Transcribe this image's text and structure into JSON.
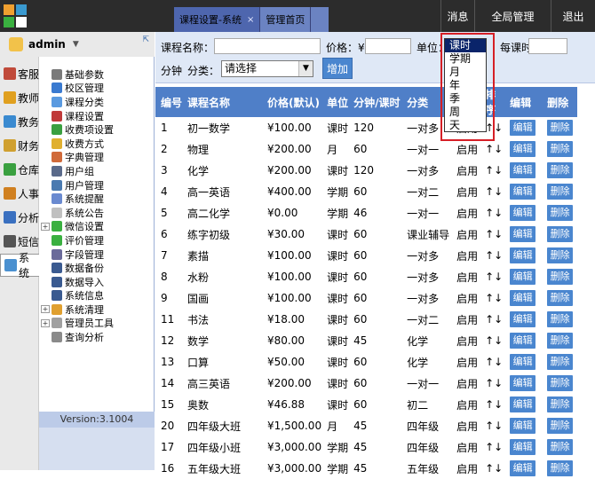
{
  "topbar": {
    "tabs": [
      {
        "label": "课程设置-系统",
        "close": "×",
        "active": true
      },
      {
        "label": "管理首页",
        "active": false
      }
    ],
    "buttons": [
      "消息",
      "全局管理",
      "退出"
    ]
  },
  "user": {
    "name": "admin",
    "caret": "▼",
    "pin": "⇱"
  },
  "rail": [
    {
      "label": "客服",
      "icon": "service-icon",
      "color": "#c04a3a"
    },
    {
      "label": "教师",
      "icon": "teacher-icon",
      "color": "#e0a020"
    },
    {
      "label": "教务",
      "icon": "academic-icon",
      "color": "#3a8ad0"
    },
    {
      "label": "财务",
      "icon": "finance-icon",
      "color": "#d0a030"
    },
    {
      "label": "仓库",
      "icon": "warehouse-icon",
      "color": "#3aa040"
    },
    {
      "label": "人事",
      "icon": "hr-icon",
      "color": "#d08020"
    },
    {
      "label": "分析",
      "icon": "analysis-icon",
      "color": "#3a70c0"
    },
    {
      "label": "短信",
      "icon": "sms-icon",
      "color": "#555555"
    },
    {
      "label": "系统",
      "icon": "system-icon",
      "color": "#4a90d0"
    }
  ],
  "tree": [
    {
      "label": "基础参数",
      "exp": "",
      "color": "#7a7a7a"
    },
    {
      "label": "校区管理",
      "exp": "",
      "color": "#3a7ad0"
    },
    {
      "label": "课程分类",
      "exp": "",
      "color": "#5a9ae0"
    },
    {
      "label": "课程设置",
      "exp": "",
      "color": "#c03a3a"
    },
    {
      "label": "收费项设置",
      "exp": "",
      "color": "#3aa040"
    },
    {
      "label": "收费方式",
      "exp": "",
      "color": "#e0b030"
    },
    {
      "label": "字典管理",
      "exp": "",
      "color": "#d06a3a"
    },
    {
      "label": "用户组",
      "exp": "",
      "color": "#5a6a8a"
    },
    {
      "label": "用户管理",
      "exp": "",
      "color": "#4a7ab0"
    },
    {
      "label": "系统提醒",
      "exp": "",
      "color": "#6a8ad0"
    },
    {
      "label": "系统公告",
      "exp": "",
      "color": "#c0c0c0"
    },
    {
      "label": "微信设置",
      "exp": "+",
      "color": "#3ab040"
    },
    {
      "label": "评价管理",
      "exp": "",
      "color": "#3ab040"
    },
    {
      "label": "字段管理",
      "exp": "",
      "color": "#6a6a9a"
    },
    {
      "label": "数据备份",
      "exp": "",
      "color": "#3a5a90"
    },
    {
      "label": "数据导入",
      "exp": "",
      "color": "#3a5a90"
    },
    {
      "label": "系统信息",
      "exp": "",
      "color": "#3a5a90"
    },
    {
      "label": "系统清理",
      "exp": "+",
      "color": "#e0a030"
    },
    {
      "label": "管理员工具",
      "exp": "+",
      "color": "#a0a0a0"
    },
    {
      "label": "查询分析",
      "exp": "",
      "color": "#8a8a8a"
    }
  ],
  "version": "Version:3.1004",
  "filter": {
    "course_name_label": "课程名称：",
    "price_label": "价格：¥",
    "unit_label": "单位：",
    "per_class_label": "每课时：",
    "minutes_label": "分钟",
    "category_label": "分类：",
    "category_value": "请选择",
    "add_label": "增加"
  },
  "unit_options": [
    "课时",
    "学期",
    "月",
    "年",
    "季",
    "周",
    "天"
  ],
  "unit_selected": 0,
  "table": {
    "headers": [
      "编号",
      "课程名称",
      "价格(默认)",
      "单位",
      "分钟/课时",
      "分类",
      "状态",
      "排序",
      "编辑",
      "删除"
    ],
    "edit_label": "编辑",
    "delete_label": "删除",
    "rows": [
      [
        "1",
        "初一数学",
        "¥100.00",
        "课时",
        "120",
        "一对多",
        "启用",
        "↑↓"
      ],
      [
        "2",
        "物理",
        "¥200.00",
        "月",
        "60",
        "一对一",
        "启用",
        "↑↓"
      ],
      [
        "3",
        "化学",
        "¥200.00",
        "课时",
        "120",
        "一对多",
        "启用",
        "↑↓"
      ],
      [
        "4",
        "高一英语",
        "¥400.00",
        "学期",
        "60",
        "一对二",
        "启用",
        "↑↓"
      ],
      [
        "5",
        "高二化学",
        "¥0.00",
        "学期",
        "46",
        "一对一",
        "启用",
        "↑↓"
      ],
      [
        "6",
        "练字初级",
        "¥30.00",
        "课时",
        "60",
        "课业辅导",
        "启用",
        "↑↓"
      ],
      [
        "7",
        "素描",
        "¥100.00",
        "课时",
        "60",
        "一对多",
        "启用",
        "↑↓"
      ],
      [
        "8",
        "水粉",
        "¥100.00",
        "课时",
        "60",
        "一对多",
        "启用",
        "↑↓"
      ],
      [
        "9",
        "国画",
        "¥100.00",
        "课时",
        "60",
        "一对多",
        "启用",
        "↑↓"
      ],
      [
        "11",
        "书法",
        "¥18.00",
        "课时",
        "60",
        "一对二",
        "启用",
        "↑↓"
      ],
      [
        "12",
        "数学",
        "¥80.00",
        "课时",
        "45",
        "化学",
        "启用",
        "↑↓"
      ],
      [
        "13",
        "口算",
        "¥50.00",
        "课时",
        "60",
        "化学",
        "启用",
        "↑↓"
      ],
      [
        "14",
        "高三英语",
        "¥200.00",
        "课时",
        "60",
        "一对一",
        "启用",
        "↑↓"
      ],
      [
        "15",
        "奥数",
        "¥46.88",
        "课时",
        "60",
        "初二",
        "启用",
        "↑↓"
      ],
      [
        "20",
        "四年级大班",
        "¥1,500.00",
        "月",
        "45",
        "四年级",
        "启用",
        "↑↓"
      ],
      [
        "17",
        "四年级小班",
        "¥3,000.00",
        "学期",
        "45",
        "四年级",
        "启用",
        "↑↓"
      ],
      [
        "16",
        "五年级大班",
        "¥3,000.00",
        "学期",
        "45",
        "五年级",
        "启用",
        "↑↓"
      ]
    ]
  }
}
